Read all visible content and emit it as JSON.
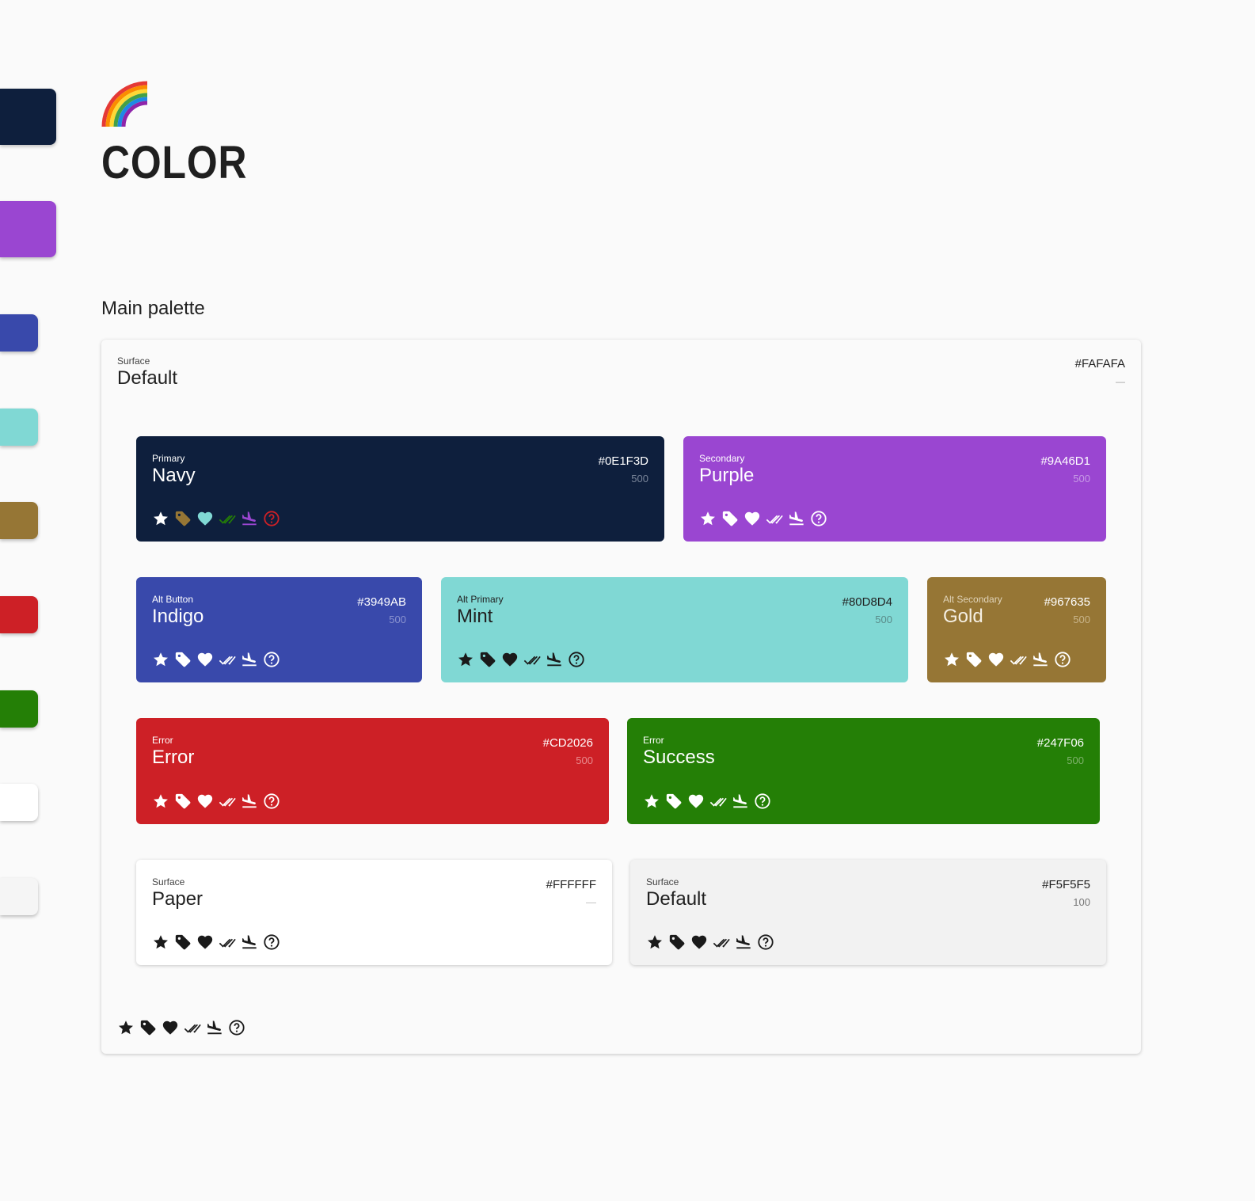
{
  "header": {
    "emoji": "🌈",
    "title": "COLOR",
    "section_title": "Main palette"
  },
  "side_swatches": [
    "#0E1F3D",
    "#9A46D1",
    "#3949AB",
    "#80D8D4",
    "#967635",
    "#CD2026",
    "#247F06",
    "#FFFFFF",
    "#F5F5F5"
  ],
  "surface": {
    "role": "Surface",
    "name": "Default",
    "hex": "#FAFAFA",
    "shade": "—"
  },
  "cards": [
    {
      "role": "Primary",
      "name": "Navy",
      "hex": "#0E1F3D",
      "shade": "500"
    },
    {
      "role": "Secondary",
      "name": "Purple",
      "hex": "#9A46D1",
      "shade": "500"
    },
    {
      "role": "Alt Button",
      "name": "Indigo",
      "hex": "#3949AB",
      "shade": "500"
    },
    {
      "role": "Alt Primary",
      "name": "Mint",
      "hex": "#80D8D4",
      "shade": "500"
    },
    {
      "role": "Alt Secondary",
      "name": "Gold",
      "hex": "#967635",
      "shade": "500"
    },
    {
      "role": "Error",
      "name": "Error",
      "hex": "#CD2026",
      "shade": "500"
    },
    {
      "role": "Error",
      "name": "Success",
      "hex": "#247F06",
      "shade": "500"
    },
    {
      "role": "Surface",
      "name": "Paper",
      "hex": "#FFFFFF",
      "shade": "—"
    },
    {
      "role": "Surface",
      "name": "Default",
      "hex": "#F5F5F5",
      "shade": "100"
    }
  ],
  "icon_names": [
    "star-icon",
    "tag-icon",
    "heart-icon",
    "double-check-icon",
    "flight-land-icon",
    "help-circle-icon"
  ],
  "colors": {
    "navy": "#0E1F3D",
    "purple": "#9A46D1",
    "indigo": "#3949AB",
    "mint": "#80D8D4",
    "gold": "#967635",
    "error": "#CD2026",
    "success": "#247F06",
    "paper": "#FFFFFF",
    "default_100": "#F5F5F5",
    "surface": "#FAFAFA"
  }
}
